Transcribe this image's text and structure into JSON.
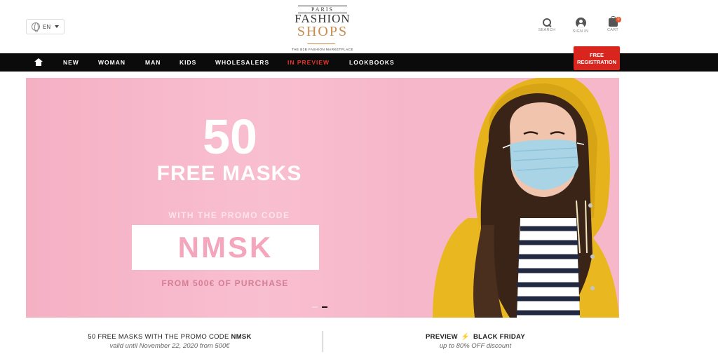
{
  "header": {
    "language": "EN",
    "logo": {
      "paris": "PARIS",
      "fashion": "FASHION",
      "shops": "SHOPS",
      "tagline": "THE B2B FASHION MARKETPLACE"
    },
    "icons": [
      {
        "name": "search-icon",
        "label": "SEARCH"
      },
      {
        "name": "user-icon",
        "label": "SIGN IN"
      },
      {
        "name": "cart-icon",
        "label": "CART",
        "badge": "0"
      }
    ]
  },
  "nav": {
    "items": [
      "NEW",
      "WOMAN",
      "MAN",
      "KIDS",
      "WHOLESALERS",
      "IN PREVIEW",
      "LOOKBOOKS"
    ],
    "free_registration": [
      "FREE",
      "REGISTRATION"
    ]
  },
  "banner": {
    "number": "50",
    "headline": "FREE MASKS",
    "with_promo": "WITH THE PROMO CODE",
    "code": "NMSK",
    "from": "FROM 500€ OF PURCHASE",
    "slides": 2,
    "active_slide": 2
  },
  "promos": {
    "left": {
      "title_prefix": "50 FREE MASKS WITH THE PROMO CODE ",
      "title_code": "NMSK",
      "subtitle": "valid until November 22, 2020 from 500€"
    },
    "right": {
      "title_a": "PREVIEW",
      "title_b": "BLACK FRIDAY",
      "subtitle": "up to 80% OFF discount"
    }
  },
  "colors": {
    "accent_red": "#e8342a",
    "banner_pink": "#f6b5c9",
    "logo_orange": "#c98a4b",
    "coat_yellow": "#e9b820"
  }
}
